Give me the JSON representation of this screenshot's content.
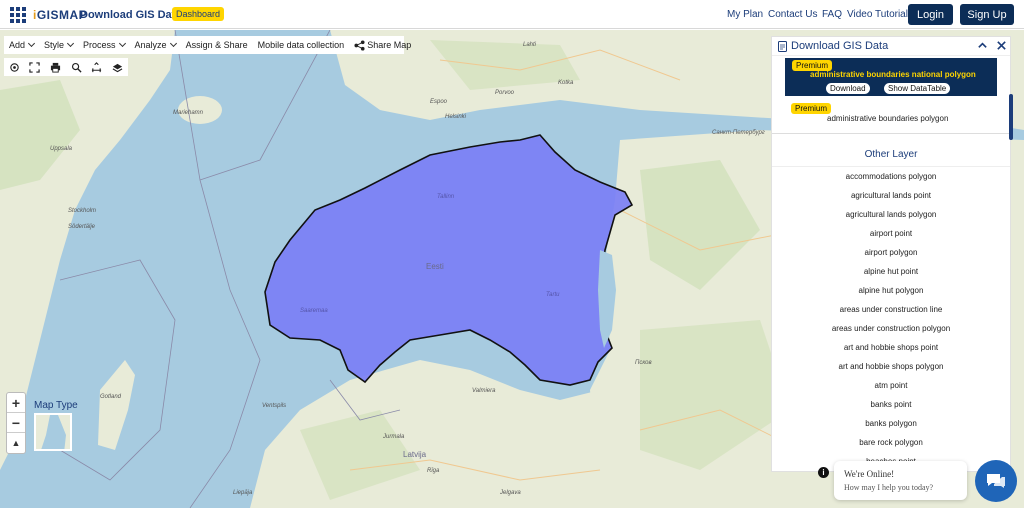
{
  "header": {
    "logo": "GISMAP",
    "title": "Download GIS Data",
    "dashboard_badge": "Dashboard",
    "nav": [
      "My Plan",
      "Contact Us",
      "FAQ",
      "Video Tutorial"
    ],
    "login": "Login",
    "signup": "Sign Up"
  },
  "toolbar": {
    "add": "Add",
    "style": "Style",
    "process": "Process",
    "analyze": "Analyze",
    "assign_share": "Assign & Share",
    "mobile": "Mobile data collection",
    "share_map": "Share Map"
  },
  "map": {
    "map_type_label": "Map Type",
    "labels": {
      "estonia": "Eesti",
      "latvia": "Latvija",
      "tallinn": "Tallinn",
      "tartu": "Tartu",
      "saaremaa": "Saaremaa",
      "helsinki": "Helsinki",
      "stockholm": "Stockholm",
      "uppsala": "Uppsala",
      "gotland": "Gotland",
      "riga": "Rīga",
      "espoo": "Espoo",
      "porvoo": "Porvoo",
      "kotka": "Kotka",
      "lahti": "Lahti",
      "mariehamn": "Mariehamn",
      "valmiera": "Valmiera",
      "jurmala": "Jurmala",
      "ventspils": "Ventspils",
      "liepaja": "Liepāja",
      "jelgava": "Jelgava",
      "pskov": "Псков",
      "spb": "Санкт-Петербург",
      "sodertalje": "Södertälje"
    }
  },
  "panel": {
    "title": "Download GIS Data",
    "premium_label": "Premium",
    "selected_layer": "administrative boundaries national polygon",
    "download_btn": "Download",
    "datatable_btn": "Show DataTable",
    "second_layer": "administrative boundaries polygon",
    "other_title": "Other Layer",
    "other_layers": [
      "accommodations polygon",
      "agricultural lands point",
      "agricultural lands polygon",
      "airport point",
      "airport polygon",
      "alpine hut point",
      "alpine hut polygon",
      "areas under construction line",
      "areas under construction polygon",
      "art and hobbie shops point",
      "art and hobbie shops polygon",
      "atm point",
      "banks point",
      "banks polygon",
      "bare rock polygon",
      "beaches point"
    ]
  },
  "chat": {
    "line1": "We're Online!",
    "line2": "How may I help you today?"
  },
  "colors": {
    "brand_navy": "#0c2d57",
    "accent_yellow": "#ffd500",
    "estonia_fill": "#7b7ff5",
    "sea": "#a7cbe0",
    "land": "#e9ecd9"
  }
}
